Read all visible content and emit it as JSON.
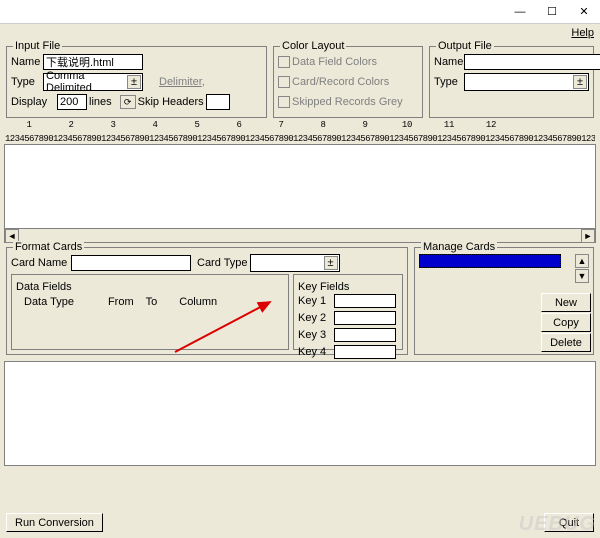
{
  "menu": {
    "help": "Help"
  },
  "input_file": {
    "legend": "Input File",
    "name_label": "Name",
    "name_value": "下载说明.html",
    "type_label": "Type",
    "type_value": "Comma Delimited",
    "display_label": "Display",
    "display_value": "200",
    "lines_label": "lines",
    "delimiter_label": "Delimiter",
    "skip_headers_label": "Skip Headers",
    "skip_headers_value": ""
  },
  "color_layout": {
    "legend": "Color Layout",
    "opt1": "Data Field Colors",
    "opt2": "Card/Record Colors",
    "opt3": "Skipped Records Grey"
  },
  "output_file": {
    "legend": "Output File",
    "name_label": "Name",
    "name_value": "",
    "type_label": "Type",
    "type_value": ""
  },
  "ruler": {
    "ticks": [
      "1",
      "2",
      "3",
      "4",
      "5",
      "6",
      "7",
      "8",
      "9",
      "10",
      "11",
      "12"
    ],
    "digits": "1234567890123456789012345678901234567890123456789012345678901234567890123456789012345678901234567890123456789012345678901234567"
  },
  "format_cards": {
    "legend": "Format Cards",
    "card_name_label": "Card Name",
    "card_name_value": "",
    "card_type_label": "Card Type",
    "card_type_value": ""
  },
  "data_fields": {
    "legend": "Data Fields",
    "col1": "Data Type",
    "col2": "From",
    "col3": "To",
    "col4": "Column"
  },
  "key_fields": {
    "legend": "Key Fields",
    "keys": [
      "Key 1",
      "Key 2",
      "Key 3",
      "Key 4"
    ]
  },
  "manage_cards": {
    "legend": "Manage Cards",
    "new": "New",
    "copy": "Copy",
    "delete": "Delete"
  },
  "footer": {
    "run": "Run Conversion",
    "quit": "Quit"
  },
  "titlebar": {
    "min": "—",
    "max": "☐",
    "close": "✕"
  }
}
